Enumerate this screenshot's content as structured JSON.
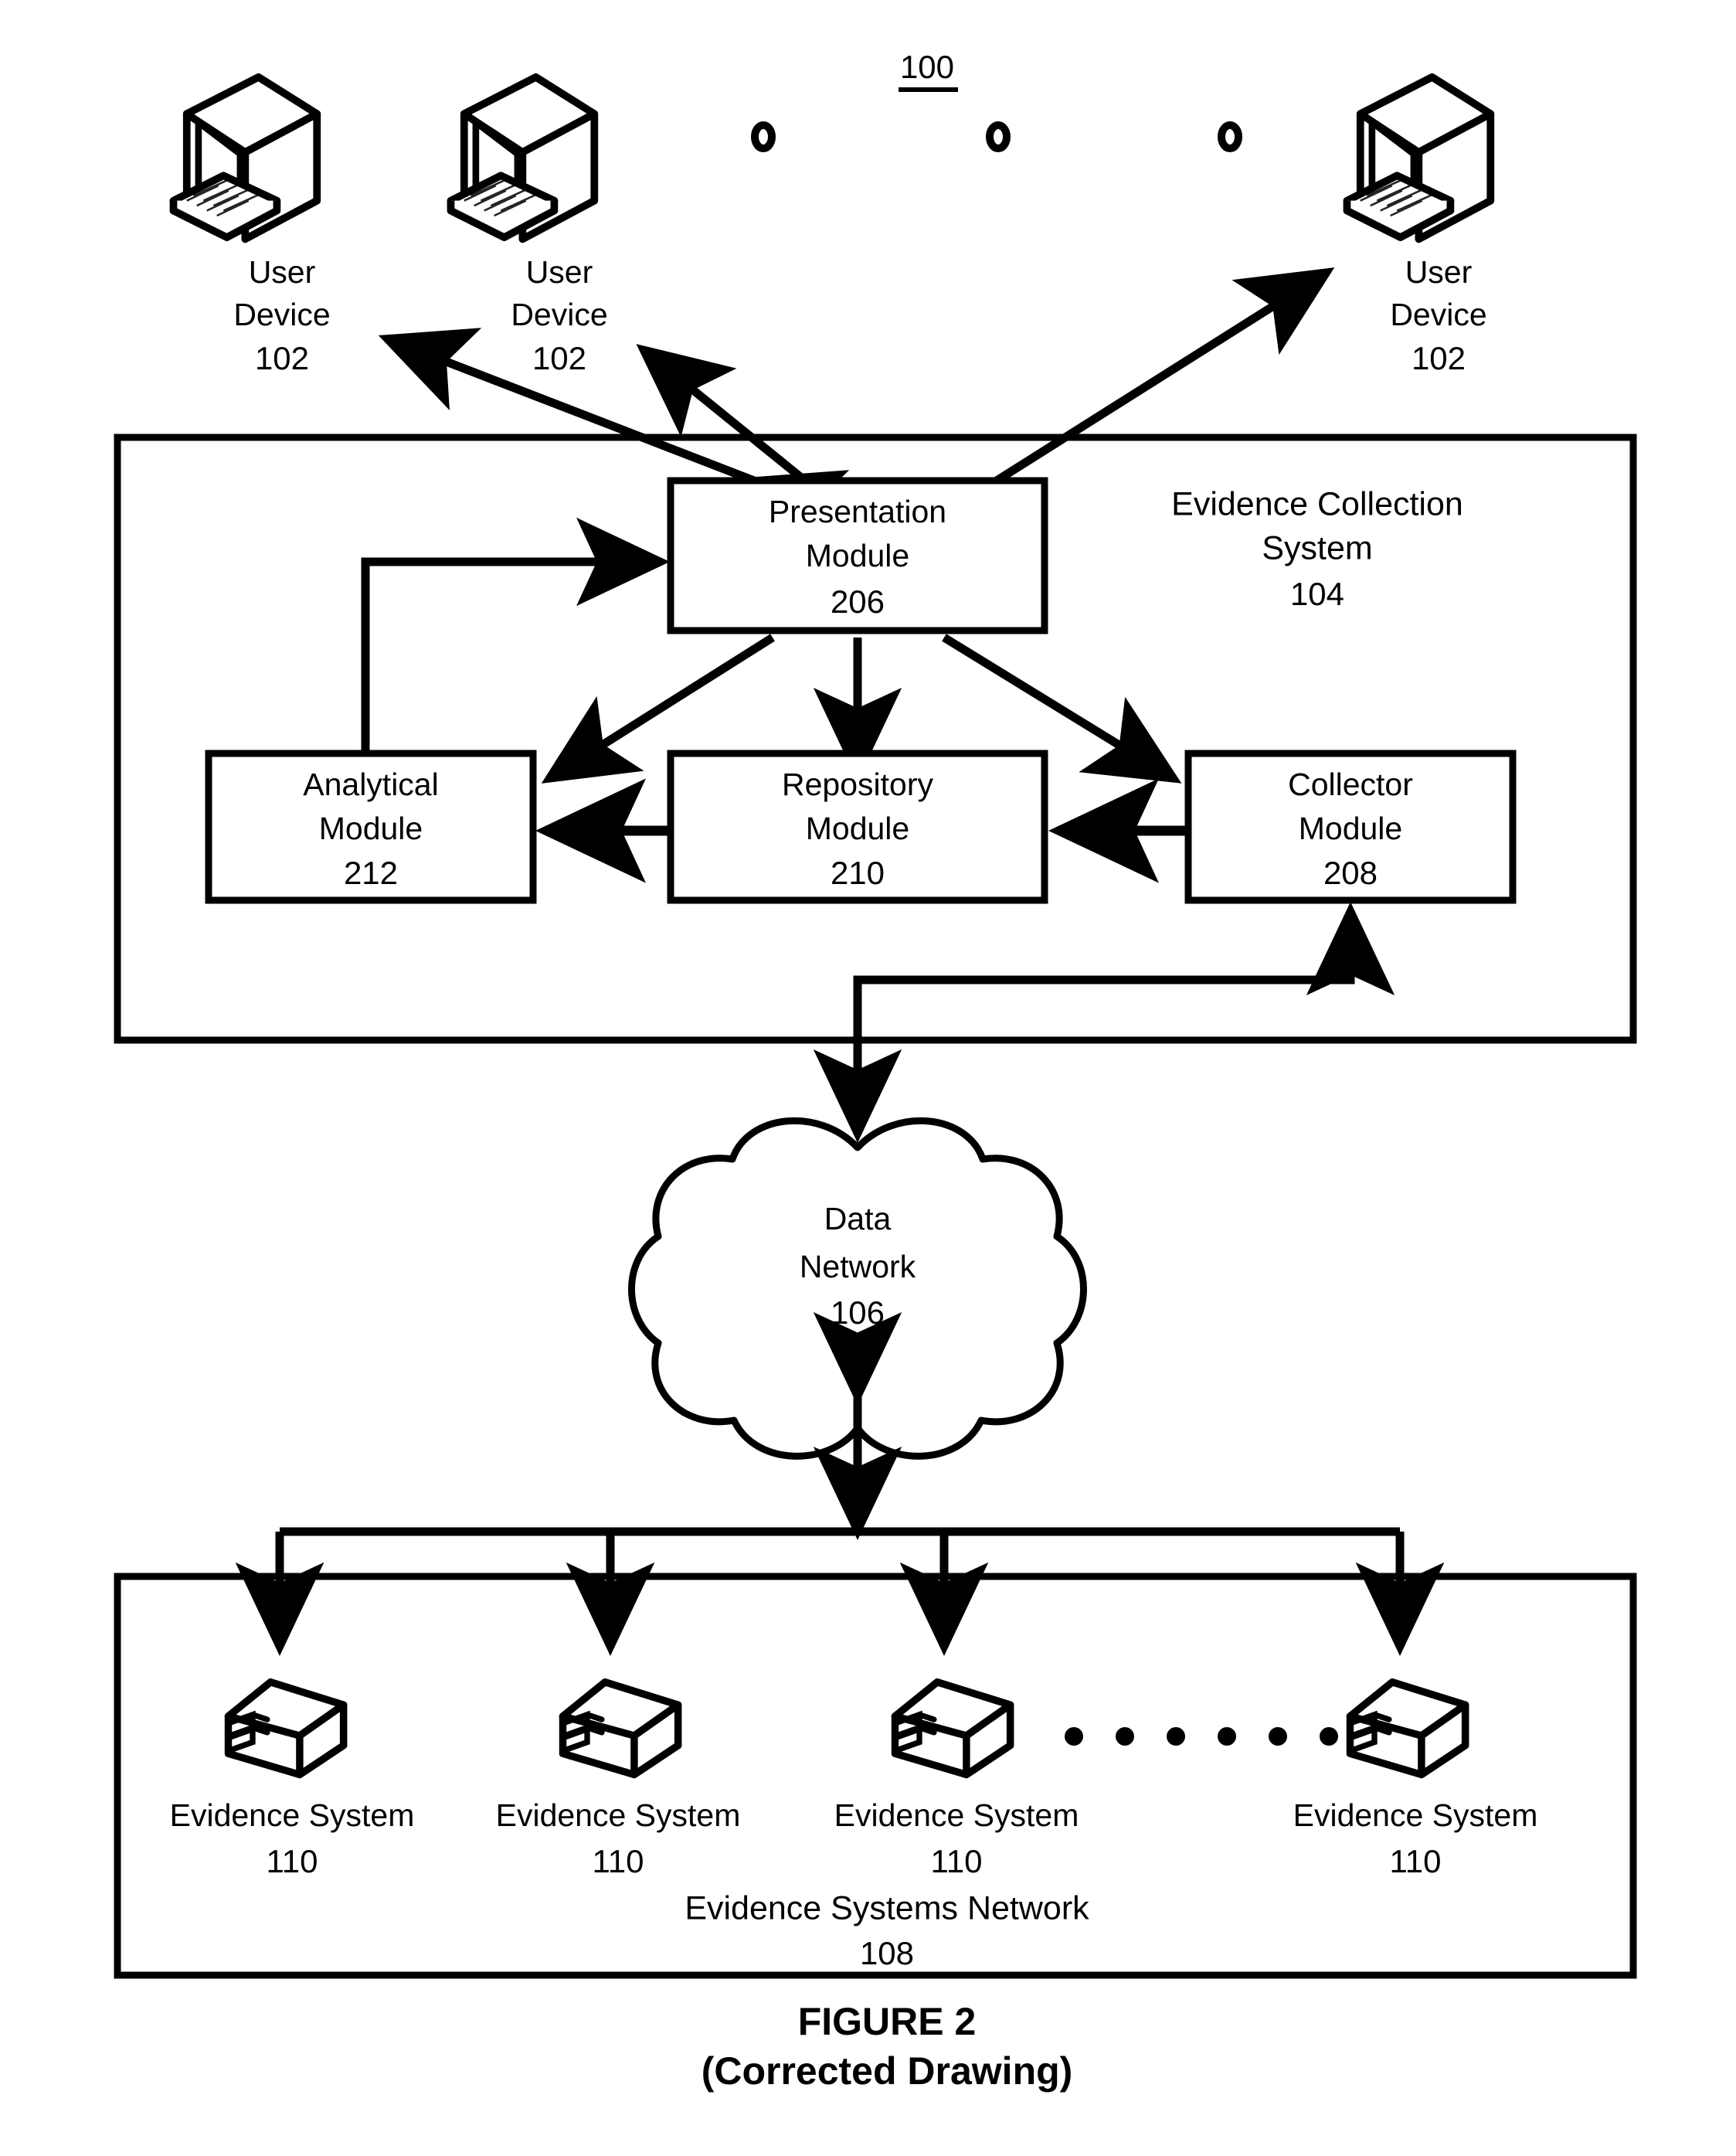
{
  "figure": {
    "reference_numeral": "100",
    "caption_line1": "FIGURE 2",
    "caption_line2": "(Corrected Drawing)"
  },
  "user_devices": [
    {
      "line1": "User",
      "line2": "Device",
      "ref": "102"
    },
    {
      "line1": "User",
      "line2": "Device",
      "ref": "102"
    },
    {
      "line1": "User",
      "line2": "Device",
      "ref": "102"
    }
  ],
  "user_device_ellipsis_count": 3,
  "evidence_collection_system": {
    "title_line1": "Evidence Collection",
    "title_line2": "System",
    "ref": "104",
    "modules": [
      {
        "line1": "Presentation",
        "line2": "Module",
        "ref": "206"
      },
      {
        "line1": "Analytical",
        "line2": "Module",
        "ref": "212"
      },
      {
        "line1": "Repository",
        "line2": "Module",
        "ref": "210"
      },
      {
        "line1": "Collector",
        "line2": "Module",
        "ref": "208"
      }
    ]
  },
  "data_network": {
    "line1": "Data",
    "line2": "Network",
    "ref": "106"
  },
  "evidence_systems_network": {
    "title": "Evidence Systems Network",
    "ref": "108",
    "systems": [
      {
        "label": "Evidence System",
        "ref": "110"
      },
      {
        "label": "Evidence System",
        "ref": "110"
      },
      {
        "label": "Evidence System",
        "ref": "110"
      },
      {
        "label": "Evidence System",
        "ref": "110"
      }
    ],
    "systems_ellipsis_count": 6
  },
  "colors": {
    "ink": "#000000",
    "paper": "#ffffff"
  }
}
